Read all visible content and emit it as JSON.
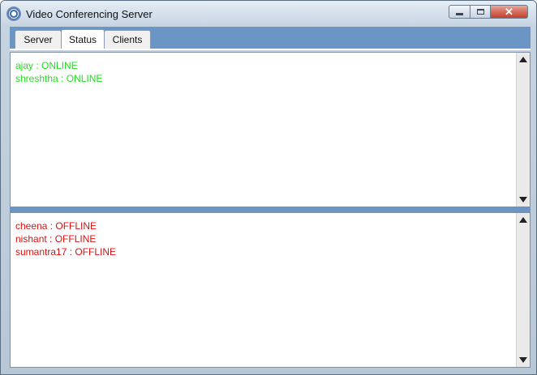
{
  "window": {
    "title": "Video Conferencing Server",
    "controls": {
      "minimize_icon": "minimize-icon",
      "maximize_icon": "maximize-icon",
      "close_icon": "close-icon",
      "close_glyph": "✕"
    }
  },
  "tabs": [
    {
      "label": "Server",
      "active": false
    },
    {
      "label": "Status",
      "active": true
    },
    {
      "label": "Clients",
      "active": false
    }
  ],
  "colors": {
    "online": "#22dd22",
    "offline": "#dd1111",
    "accent": "#6b95c5"
  },
  "online_list": [
    {
      "text": "ajay : ONLINE"
    },
    {
      "text": "shreshtha : ONLINE"
    }
  ],
  "offline_list": [
    {
      "text": "cheena : OFFLINE"
    },
    {
      "text": "nishant : OFFLINE"
    },
    {
      "text": "sumantra17 : OFFLINE"
    }
  ]
}
